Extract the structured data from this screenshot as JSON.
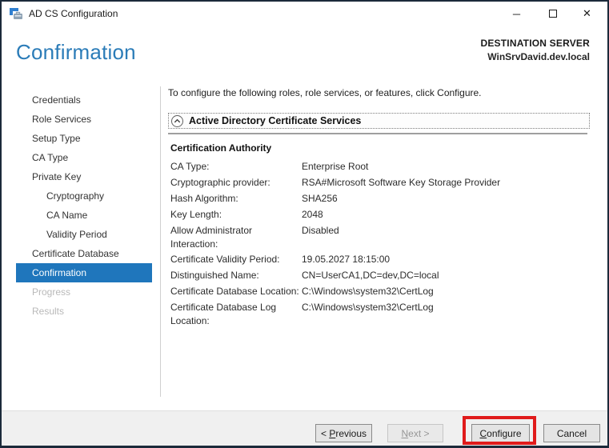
{
  "window": {
    "title": "AD CS Configuration",
    "controls": {
      "minimize_glyph": "─",
      "close_glyph": "✕"
    }
  },
  "header": {
    "page_title": "Confirmation",
    "destination_label": "DESTINATION SERVER",
    "destination_server": "WinSrvDavid.dev.local"
  },
  "sidebar": {
    "items": [
      {
        "label": "Credentials",
        "state": "normal",
        "level": 0
      },
      {
        "label": "Role Services",
        "state": "normal",
        "level": 0
      },
      {
        "label": "Setup Type",
        "state": "normal",
        "level": 0
      },
      {
        "label": "CA Type",
        "state": "normal",
        "level": 0
      },
      {
        "label": "Private Key",
        "state": "normal",
        "level": 0
      },
      {
        "label": "Cryptography",
        "state": "normal",
        "level": 1
      },
      {
        "label": "CA Name",
        "state": "normal",
        "level": 1
      },
      {
        "label": "Validity Period",
        "state": "normal",
        "level": 1
      },
      {
        "label": "Certificate Database",
        "state": "normal",
        "level": 0
      },
      {
        "label": "Confirmation",
        "state": "selected",
        "level": 0
      },
      {
        "label": "Progress",
        "state": "disabled",
        "level": 0
      },
      {
        "label": "Results",
        "state": "disabled",
        "level": 0
      }
    ]
  },
  "main": {
    "instruction": "To configure the following roles, role services, or features, click Configure.",
    "expander": {
      "label": "Active Directory Certificate Services",
      "icon": "chevron-up-circle-icon"
    },
    "section_title": "Certification Authority",
    "fields": [
      {
        "label": "CA Type:",
        "value": "Enterprise Root"
      },
      {
        "label": "Cryptographic provider:",
        "value": "RSA#Microsoft Software Key Storage Provider"
      },
      {
        "label": "Hash Algorithm:",
        "value": "SHA256"
      },
      {
        "label": "Key Length:",
        "value": "2048"
      },
      {
        "label": "Allow Administrator Interaction:",
        "value": "Disabled"
      },
      {
        "label": "Certificate Validity Period:",
        "value": "19.05.2027 18:15:00"
      },
      {
        "label": "Distinguished Name:",
        "value": "CN=UserCA1,DC=dev,DC=local"
      },
      {
        "label": "Certificate Database Location:",
        "value": "C:\\Windows\\system32\\CertLog"
      },
      {
        "label": "Certificate Database Log Location:",
        "value": "C:\\Windows\\system32\\CertLog"
      }
    ]
  },
  "footer": {
    "buttons": [
      {
        "name": "previous",
        "pre": "< ",
        "mnemonic": "P",
        "post": "revious",
        "enabled": true
      },
      {
        "name": "next",
        "pre": "",
        "mnemonic": "N",
        "post": "ext >",
        "enabled": false
      },
      {
        "name": "configure",
        "pre": "",
        "mnemonic": "C",
        "post": "onfigure",
        "enabled": true
      },
      {
        "name": "cancel",
        "pre": "Cancel",
        "mnemonic": "",
        "post": "",
        "enabled": true
      }
    ]
  },
  "colors": {
    "heading_blue": "#2b7cb8",
    "selected_item_blue": "#1f76bc",
    "annotation_red": "#e01b1b",
    "window_border": "#1b2a3a"
  }
}
